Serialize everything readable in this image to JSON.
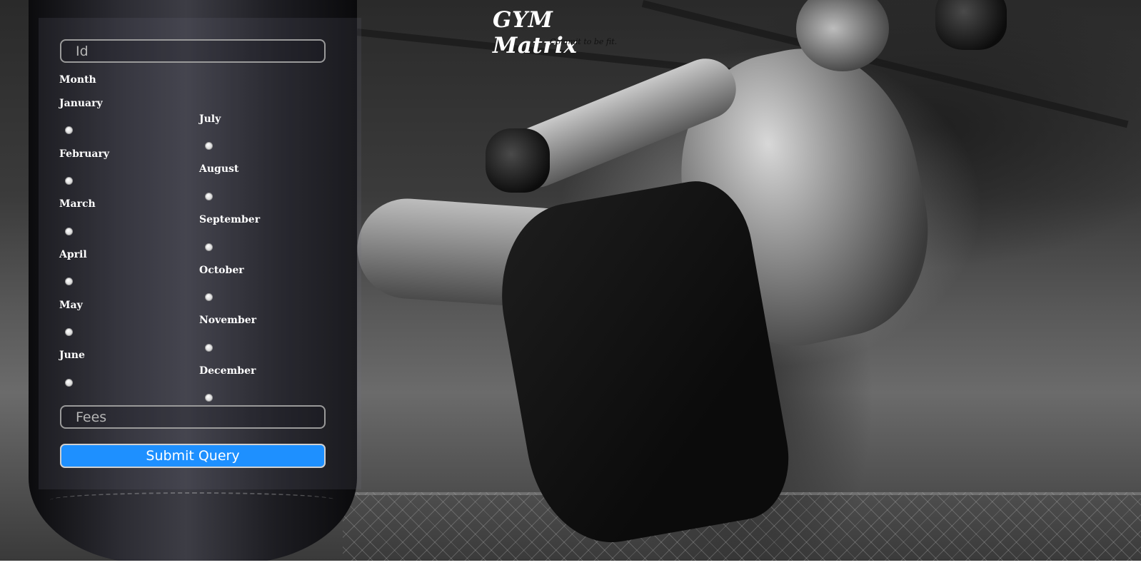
{
  "brand": {
    "title": "GYM Matrix",
    "tagline": "Commit to be fit."
  },
  "form": {
    "id_field": {
      "placeholder": "Id",
      "value": ""
    },
    "month_heading": "Month",
    "months_left": [
      "January",
      "February",
      "March",
      "April",
      "May",
      "June"
    ],
    "months_right": [
      "July",
      "August",
      "September",
      "October",
      "November",
      "December"
    ],
    "selected_month": "",
    "fees_field": {
      "placeholder": "Fees",
      "value": ""
    },
    "submit_label": "Submit Query"
  },
  "colors": {
    "submit_bg": "#1e90ff",
    "text": "#ffffff"
  }
}
